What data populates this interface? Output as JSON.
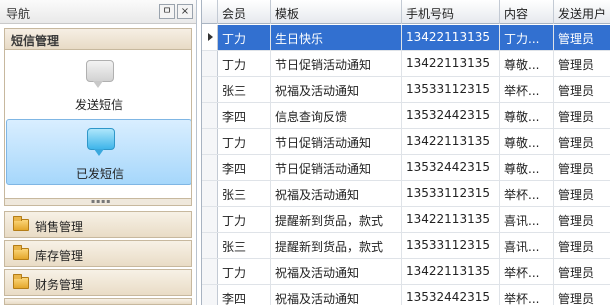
{
  "nav": {
    "title": "导航",
    "pin_glyph": "ㅁ",
    "close_glyph": "×",
    "group_title": "短信管理",
    "items": [
      {
        "label": "发送短信",
        "icon": "message-bubble-icon"
      },
      {
        "label": "已发短信",
        "icon": "message-bubble-icon",
        "selected": true
      }
    ],
    "groups": [
      {
        "label": "销售管理",
        "icon": "folder-icon"
      },
      {
        "label": "库存管理",
        "icon": "folder-icon"
      },
      {
        "label": "财务管理",
        "icon": "folder-icon"
      }
    ]
  },
  "grid": {
    "columns": [
      "会员",
      "模板",
      "手机号码",
      "内容",
      "发送用户"
    ],
    "rows": [
      {
        "member": "丁力",
        "template": "生日快乐",
        "phone": "13422113135",
        "content": "丁力...",
        "user": "管理员",
        "selected": true
      },
      {
        "member": "丁力",
        "template": "节日促销活动通知",
        "phone": "13422113135",
        "content": "尊敬...",
        "user": "管理员"
      },
      {
        "member": "张三",
        "template": "祝福及活动通知",
        "phone": "13533112315",
        "content": "举杯...",
        "user": "管理员"
      },
      {
        "member": "李四",
        "template": "信息查询反馈",
        "phone": "13532442315",
        "content": "尊敬...",
        "user": "管理员"
      },
      {
        "member": "丁力",
        "template": "节日促销活动通知",
        "phone": "13422113135",
        "content": "尊敬...",
        "user": "管理员"
      },
      {
        "member": "李四",
        "template": "节日促销活动通知",
        "phone": "13532442315",
        "content": "尊敬...",
        "user": "管理员"
      },
      {
        "member": "张三",
        "template": "祝福及活动通知",
        "phone": "13533112315",
        "content": "举杯...",
        "user": "管理员"
      },
      {
        "member": "丁力",
        "template": "提醒新到货品，款式",
        "phone": "13422113135",
        "content": "喜讯...",
        "user": "管理员"
      },
      {
        "member": "张三",
        "template": "提醒新到货品，款式",
        "phone": "13533112315",
        "content": "喜讯...",
        "user": "管理员"
      },
      {
        "member": "丁力",
        "template": "祝福及活动通知",
        "phone": "13422113135",
        "content": "举杯...",
        "user": "管理员"
      },
      {
        "member": "李四",
        "template": "祝福及活动通知",
        "phone": "13532442315",
        "content": "举杯...",
        "user": "管理员"
      }
    ]
  },
  "colors": {
    "selection": "#3270d0",
    "selected_item": "#a6d7fb",
    "group_header": "#e9dcc6"
  }
}
